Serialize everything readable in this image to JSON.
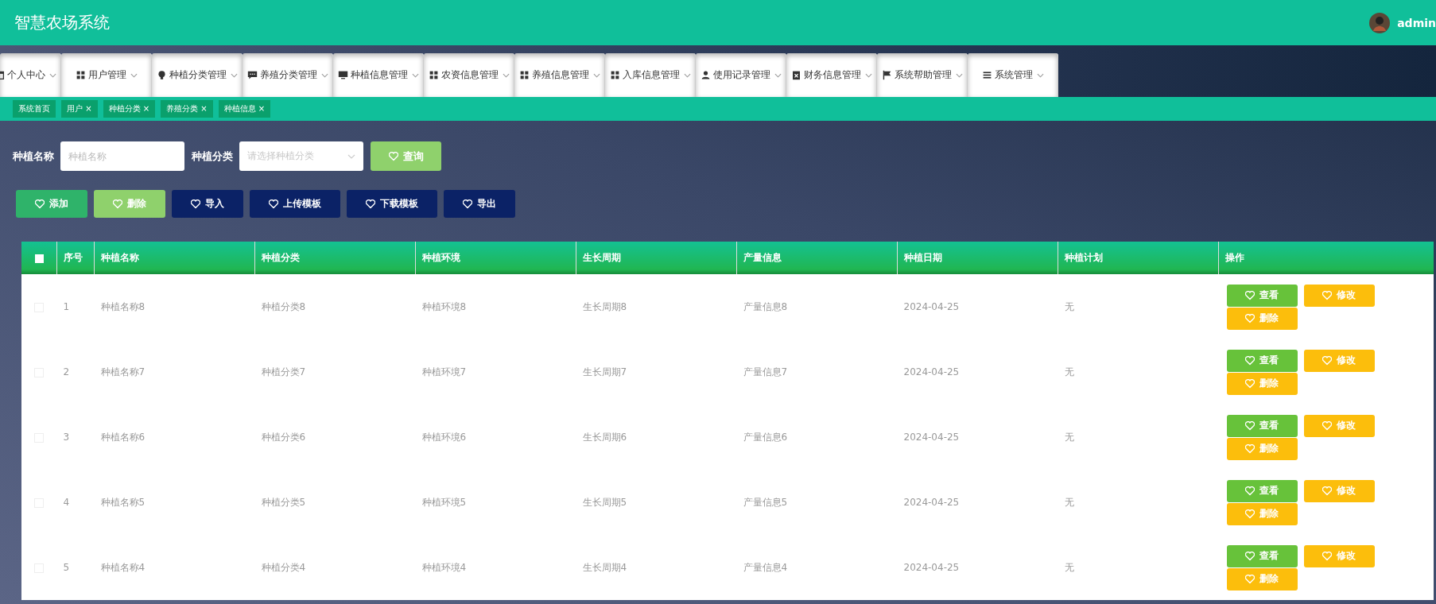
{
  "header": {
    "title": "智慧农场系统",
    "user": "admin"
  },
  "menu": [
    {
      "label": "个人中心"
    },
    {
      "label": "用户管理"
    },
    {
      "label": "种植分类管理"
    },
    {
      "label": "养殖分类管理"
    },
    {
      "label": "种植信息管理"
    },
    {
      "label": "农资信息管理"
    },
    {
      "label": "养殖信息管理"
    },
    {
      "label": "入库信息管理"
    },
    {
      "label": "使用记录管理"
    },
    {
      "label": "财务信息管理"
    },
    {
      "label": "系统帮助管理"
    },
    {
      "label": "系统管理"
    }
  ],
  "tags": [
    {
      "label": "系统首页"
    },
    {
      "label": "用户",
      "close": "×"
    },
    {
      "label": "种植分类",
      "close": "×"
    },
    {
      "label": "养殖分类",
      "close": "×"
    },
    {
      "label": "种植信息",
      "close": "×"
    }
  ],
  "search": {
    "fields": [
      {
        "kind": "input",
        "label": "种植名称",
        "placeholder": "种植名称"
      },
      {
        "kind": "select",
        "label": "种植分类",
        "placeholder": "请选择种植分类"
      }
    ],
    "button": "查询"
  },
  "actions": [
    {
      "label": "添加",
      "color": "#2fb36a"
    },
    {
      "label": "删除",
      "color": "#8fd16c"
    },
    {
      "label": "导入",
      "color": "#0b2266"
    },
    {
      "label": "上传模板",
      "color": "#0b2266"
    },
    {
      "label": "下载模板",
      "color": "#0b2266"
    },
    {
      "label": "导出",
      "color": "#0b2266"
    }
  ],
  "table": {
    "header_checked": false,
    "columns": [
      "序号",
      "种植名称",
      "种植分类",
      "种植环境",
      "生长周期",
      "产量信息",
      "种植日期",
      "种植计划",
      "操作"
    ],
    "rows": [
      {
        "checked": false,
        "cells": [
          "1",
          "种植名称8",
          "种植分类8",
          "种植环境8",
          "生长周期8",
          "产量信息8",
          "2024-04-25",
          "无"
        ],
        "buttons": [
          {
            "kind": "view",
            "label": "查看"
          },
          {
            "kind": "edit",
            "label": "修改"
          },
          {
            "kind": "delete",
            "label": "删除"
          }
        ]
      },
      {
        "checked": false,
        "cells": [
          "2",
          "种植名称7",
          "种植分类7",
          "种植环境7",
          "生长周期7",
          "产量信息7",
          "2024-04-25",
          "无"
        ],
        "buttons": [
          {
            "kind": "view",
            "label": "查看"
          },
          {
            "kind": "edit",
            "label": "修改"
          },
          {
            "kind": "delete",
            "label": "删除"
          }
        ]
      },
      {
        "checked": false,
        "cells": [
          "3",
          "种植名称6",
          "种植分类6",
          "种植环境6",
          "生长周期6",
          "产量信息6",
          "2024-04-25",
          "无"
        ],
        "buttons": [
          {
            "kind": "view",
            "label": "查看"
          },
          {
            "kind": "edit",
            "label": "修改"
          },
          {
            "kind": "delete",
            "label": "删除"
          }
        ]
      },
      {
        "checked": false,
        "cells": [
          "4",
          "种植名称5",
          "种植分类5",
          "种植环境5",
          "生长周期5",
          "产量信息5",
          "2024-04-25",
          "无"
        ],
        "buttons": [
          {
            "kind": "view",
            "label": "查看"
          },
          {
            "kind": "edit",
            "label": "修改"
          },
          {
            "kind": "delete",
            "label": "删除"
          }
        ]
      },
      {
        "checked": false,
        "cells": [
          "5",
          "种植名称4",
          "种植分类4",
          "种植环境4",
          "生长周期4",
          "产量信息4",
          "2024-04-25",
          "无"
        ],
        "buttons": [
          {
            "kind": "view",
            "label": "查看"
          },
          {
            "kind": "edit",
            "label": "修改"
          },
          {
            "kind": "delete",
            "label": "删除"
          }
        ]
      }
    ]
  }
}
